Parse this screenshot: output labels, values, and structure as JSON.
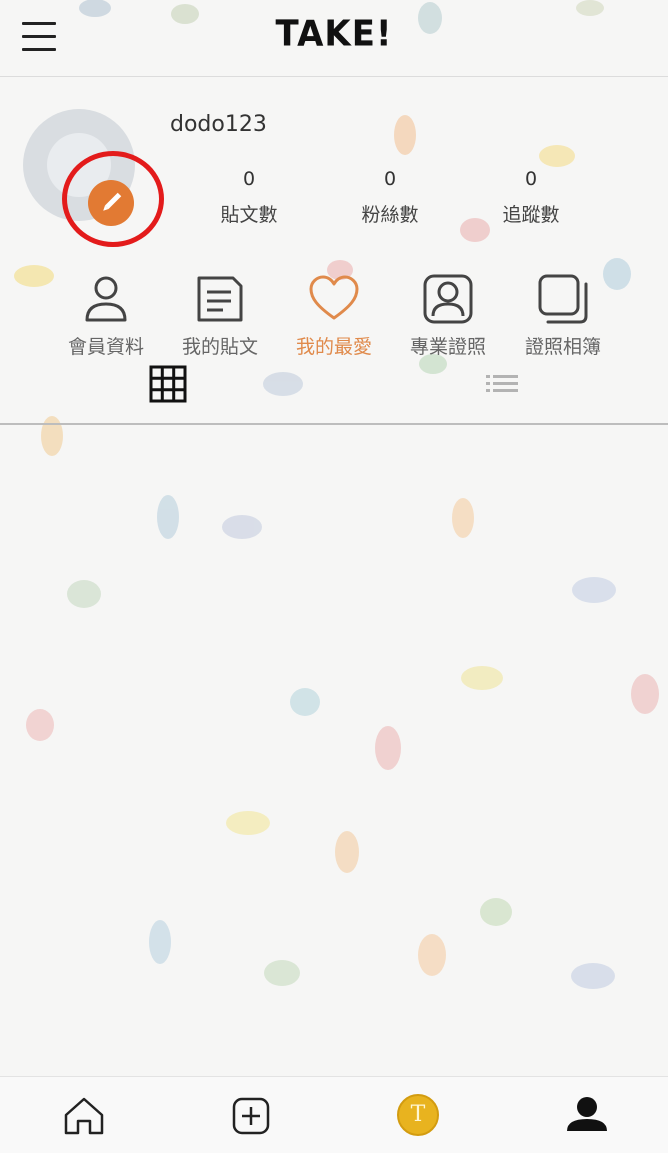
{
  "header": {
    "logo_text": "TAKE!",
    "menu_icon": "hamburger-menu-icon"
  },
  "profile": {
    "username": "dodo123",
    "edit_icon": "pencil-icon",
    "highlight_color": "#e31b1b",
    "accent_color": "#e27a33",
    "stats": [
      {
        "value": "0",
        "label": "貼文數"
      },
      {
        "value": "0",
        "label": "粉絲數"
      },
      {
        "value": "0",
        "label": "追蹤數"
      }
    ]
  },
  "nav": {
    "items": [
      {
        "label": "會員資料",
        "icon": "user-icon"
      },
      {
        "label": "我的貼文",
        "icon": "post-icon"
      },
      {
        "label": "我的最愛",
        "icon": "heart-icon",
        "active": true
      },
      {
        "label": "專業證照",
        "icon": "certificate-icon"
      },
      {
        "label": "證照相簿",
        "icon": "album-icon"
      }
    ]
  },
  "view_toggle": {
    "grid_icon": "grid-icon",
    "list_icon": "list-icon",
    "selected": "grid"
  },
  "bottom_bar": {
    "tabs": [
      {
        "icon": "home-icon"
      },
      {
        "icon": "add-icon"
      },
      {
        "icon": "coin-icon",
        "text": "T"
      },
      {
        "icon": "profile-icon",
        "active": true
      }
    ]
  }
}
